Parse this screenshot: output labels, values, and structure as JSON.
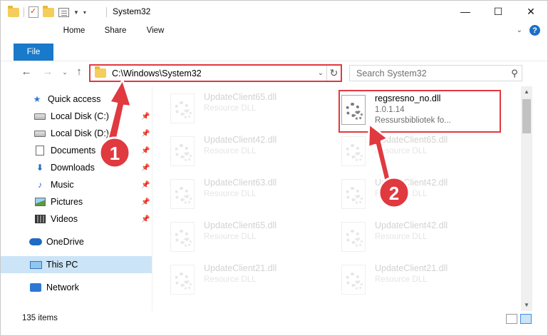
{
  "window": {
    "title": "System32",
    "buttons": {
      "minimize": "—",
      "maximize": "☐",
      "close": "✕"
    }
  },
  "ribbon": {
    "tabs": [
      "File",
      "Home",
      "Share",
      "View"
    ]
  },
  "address": {
    "path": "C:\\Windows\\System32",
    "search_placeholder": "Search System32"
  },
  "nav": {
    "items": [
      {
        "label": "Quick access",
        "icon": "star-icon",
        "pinned": false
      },
      {
        "label": "Local Disk (C:)",
        "icon": "disk-icon",
        "pinned": true
      },
      {
        "label": "Local Disk (D:)",
        "icon": "disk-icon",
        "pinned": true
      },
      {
        "label": "Documents",
        "icon": "document-icon",
        "pinned": true
      },
      {
        "label": "Downloads",
        "icon": "download-icon",
        "pinned": true
      },
      {
        "label": "Music",
        "icon": "music-icon",
        "pinned": true
      },
      {
        "label": "Pictures",
        "icon": "pictures-icon",
        "pinned": true
      },
      {
        "label": "Videos",
        "icon": "videos-icon",
        "pinned": true
      },
      {
        "label": "OneDrive",
        "icon": "onedrive-icon",
        "pinned": false
      },
      {
        "label": "This PC",
        "icon": "this-pc-icon",
        "pinned": false,
        "selected": true
      },
      {
        "label": "Network",
        "icon": "network-icon",
        "pinned": false
      }
    ]
  },
  "files": {
    "left_column": [
      {
        "name": "UpdateClient65.dll",
        "type": "Resource DLL"
      },
      {
        "name": "UpdateClient42.dll",
        "type": "Resource DLL"
      },
      {
        "name": "UpdateClient63.dll",
        "type": "Resource DLL"
      },
      {
        "name": "UpdateClient65.dll",
        "type": "Resource DLL"
      },
      {
        "name": "UpdateClient21.dll",
        "type": "Resource DLL"
      }
    ],
    "highlighted": {
      "name": "regsresno_no.dll",
      "version": "1.0.1.14",
      "description": "Ressursbibliotek fo..."
    },
    "right_column": [
      {
        "name": "UpdateClient65.dll",
        "type": "Resource DLL"
      },
      {
        "name": "UpdateClient42.dll",
        "type": "Resource DLL"
      },
      {
        "name": "UpdateClient42.dll",
        "type": "Resource DLL"
      },
      {
        "name": "UpdateClient21.dll",
        "type": "Resource DLL"
      }
    ]
  },
  "status": {
    "item_count": "135 items"
  },
  "annotations": {
    "step1": "1",
    "step2": "2",
    "color": "#e03940"
  }
}
